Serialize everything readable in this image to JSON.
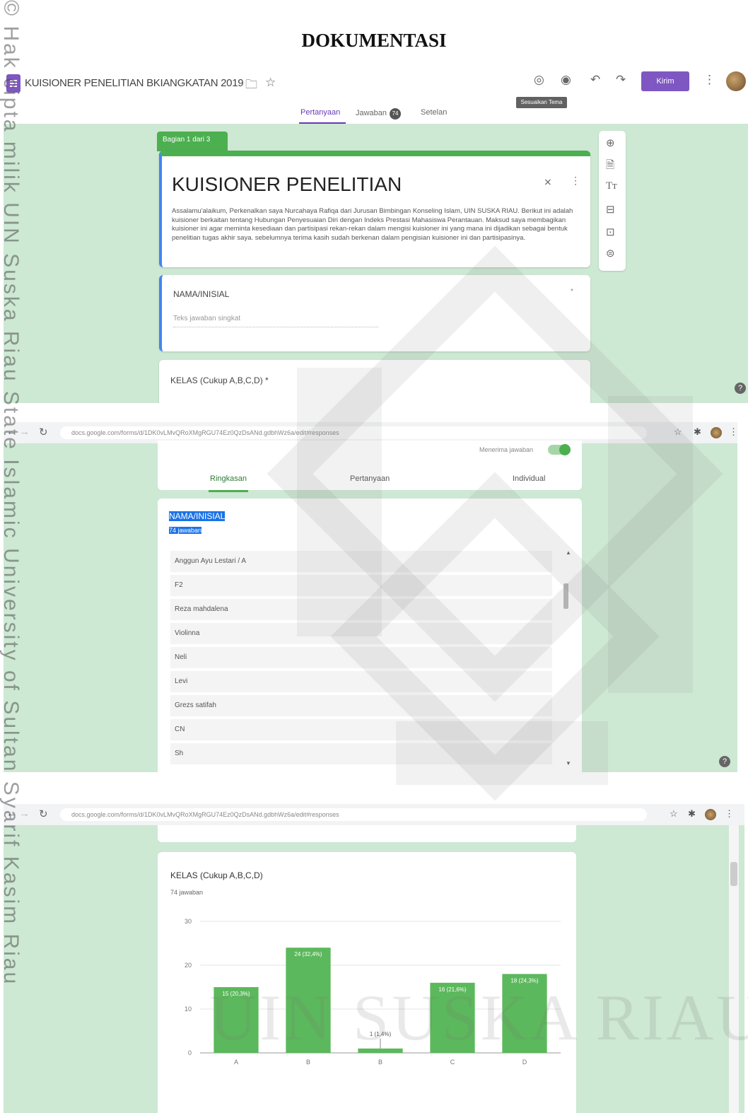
{
  "watermark": {
    "side_text": "© Hak cipta milik UIN Suska Riau                State Islamic University of Sultan Syarif Kasim Riau",
    "center_text": "UIN SUSKA RIAU"
  },
  "doc_title": "DOKUMENTASI",
  "form_editor": {
    "form_title": "KUISIONER PENELITIAN BKIANGKATAN 2019",
    "send_button": "Kirim",
    "tooltip": "Sesuaikan Tema",
    "tabs": [
      {
        "label": "Pertanyaan"
      },
      {
        "label": "Jawaban",
        "badge": "74"
      },
      {
        "label": "Setelan"
      }
    ],
    "section_label": "Bagian 1 dari 3",
    "card_title": "KUISIONER PENELITIAN",
    "card_description": "Assalamu'alaikum, Perkenalkan saya Nurcahaya Rafiqa dari Jurusan Bimbingan Konseling Islam, UIN SUSKA RIAU. Berikut ini adalah kuisioner berkaitan tentang Hubungan Penyesuaian Diri dengan Indeks Prestasi Mahasiswa Perantauan. Maksud saya membagikan kuisioner ini agar meminta kesediaan dan partisipasi rekan-rekan dalam mengisi kuisioner ini yang mana ini dijadikan sebagai bentuk penelitian tugas akhir saya. sebelumnya terima kasih sudah berkenan dalam pengisian kuisioner ini dan partisipasinya.",
    "question1_label": "NAMA/INISIAL",
    "question1_placeholder": "Teks jawaban singkat",
    "question2_label": "KELAS (Cukup A,B,C,D) *"
  },
  "responses_view": {
    "url": "docs.google.com/forms/d/1DK0vLMvQRoXMgRGU74Ez0QzDsANd.gdbhWz6a/edit#responses",
    "toggle_label": "Menerima jawaban",
    "tabs": [
      "Ringkasan",
      "Pertanyaan",
      "Individual"
    ],
    "question_label": "NAMA/INISIAL",
    "response_count": "74 jawaban",
    "responses": [
      "Anggun Ayu Lestari / A",
      "F2",
      "Reza mahdalena",
      "Violinna",
      "Neli",
      "Levi",
      "Grezs satifah",
      "CN",
      "Sh"
    ]
  },
  "chart_view": {
    "url": "docs.google.com/forms/d/1DK0vLMvQRoXMgRGU74Ez0QzDsANd.gdbhWz6a/edit#responses",
    "question_label": "KELAS (Cukup A,B,C,D)",
    "response_count": "74 jawaban"
  },
  "chart_data": {
    "type": "bar",
    "categories": [
      "A",
      "B",
      "B",
      "C",
      "D"
    ],
    "values": [
      15,
      24,
      1,
      16,
      18
    ],
    "data_labels": [
      "15 (20,3%)",
      "24 (32,4%)",
      "1 (1,4%)",
      "16 (21,6%)",
      "18 (24,3%)"
    ],
    "yticks": [
      0,
      10,
      20,
      30
    ],
    "ylim": [
      0,
      30
    ],
    "title": "KELAS (Cukup A,B,C,D)",
    "bar_color": "#5cb85c",
    "grid": true
  }
}
